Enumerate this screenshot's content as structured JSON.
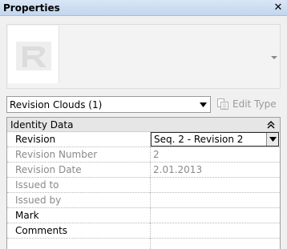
{
  "panel": {
    "title": "Properties",
    "close_icon": "close-icon"
  },
  "type_selector": {
    "value": "Revision Clouds (1)",
    "icon": "chevron-down-icon"
  },
  "edit_type": {
    "label": "Edit Type",
    "icon": "edit-type-icon",
    "enabled": false
  },
  "group": {
    "label": "Identity Data",
    "icon": "collapse-double-chevron-up-icon"
  },
  "rows": [
    {
      "name": "Revision",
      "value": "Seq. 2 - Revision 2",
      "editable": true
    },
    {
      "name": "Revision Number",
      "value": "2",
      "editable": false
    },
    {
      "name": "Revision Date",
      "value": "2.01.2013",
      "editable": false
    },
    {
      "name": "Issued to",
      "value": "",
      "editable": false
    },
    {
      "name": "Issued by",
      "value": "",
      "editable": false
    },
    {
      "name": "Mark",
      "value": "",
      "editable": true
    },
    {
      "name": "Comments",
      "value": "",
      "editable": true
    }
  ]
}
